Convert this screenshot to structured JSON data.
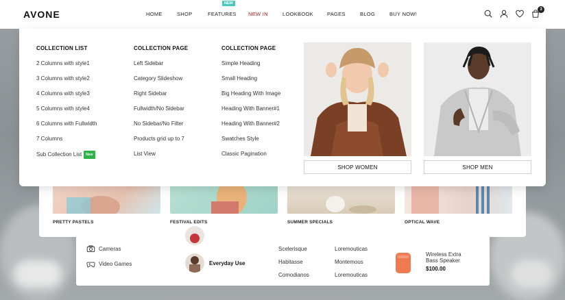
{
  "brand": {
    "logo": "AVONE"
  },
  "nav": {
    "items": [
      "HOME",
      "SHOP",
      "FEATURES",
      "NEW IN",
      "LOOKBOOK",
      "PAGES",
      "BLOG",
      "BUY NOW!"
    ],
    "features_badge": "NEW",
    "active_item": "NEW IN"
  },
  "header_icons": [
    "search-icon",
    "user-icon",
    "heart-icon",
    "cart-icon"
  ],
  "cart_count": "3",
  "colors": {
    "accent_red": "#b51d25",
    "badge_teal": "#4ac8c0",
    "badge_green": "#2db34a"
  },
  "megamenu": {
    "columns": [
      {
        "title": "COLLECTION LIST",
        "links": [
          "2 Columns with style1",
          "3 Columns with style2",
          "4 Columns with style3",
          "5 Columns with style4",
          "6 Columns with Fullwidth",
          "7 Columns",
          "Sub Collection List"
        ]
      },
      {
        "title": "COLLECTION PAGE",
        "links": [
          "Left Sidebar",
          "Category Slideshow",
          "Right Sidebar",
          "Fullwidth/No Sidebar",
          "No Sidebar/No Filter",
          "Products grid up to 7",
          "List View"
        ]
      },
      {
        "title": "COLLECTION PAGE",
        "links": [
          "Simple Heading",
          "Small Heading",
          "Big Heading With Image",
          "Heading With Banner#1",
          "Heading With Banner#2",
          "Swatches Style",
          "Classic Pagination"
        ]
      }
    ],
    "sub_collection_badge": "New",
    "promos": [
      {
        "button": "SHOP WOMEN"
      },
      {
        "button": "SHOP MEN"
      }
    ]
  },
  "categories": [
    "PRETTY PASTELS",
    "FESTIVAL EDITS",
    "SUMMER SPECIALS",
    "OPTICAL WAVE"
  ],
  "bottom": {
    "side_links": [
      "Cameras",
      "Video Games"
    ],
    "featured": "Everyday Use",
    "brands_col1": [
      "Scelerisque",
      "Habitasse",
      "Comodianos"
    ],
    "brands_col2": [
      "Loremouticas",
      "Montemous",
      "Loremouticas"
    ],
    "product": {
      "name_line1": "Wireless Extra",
      "name_line2": "Bass Speaker",
      "price": "$100.00"
    }
  }
}
